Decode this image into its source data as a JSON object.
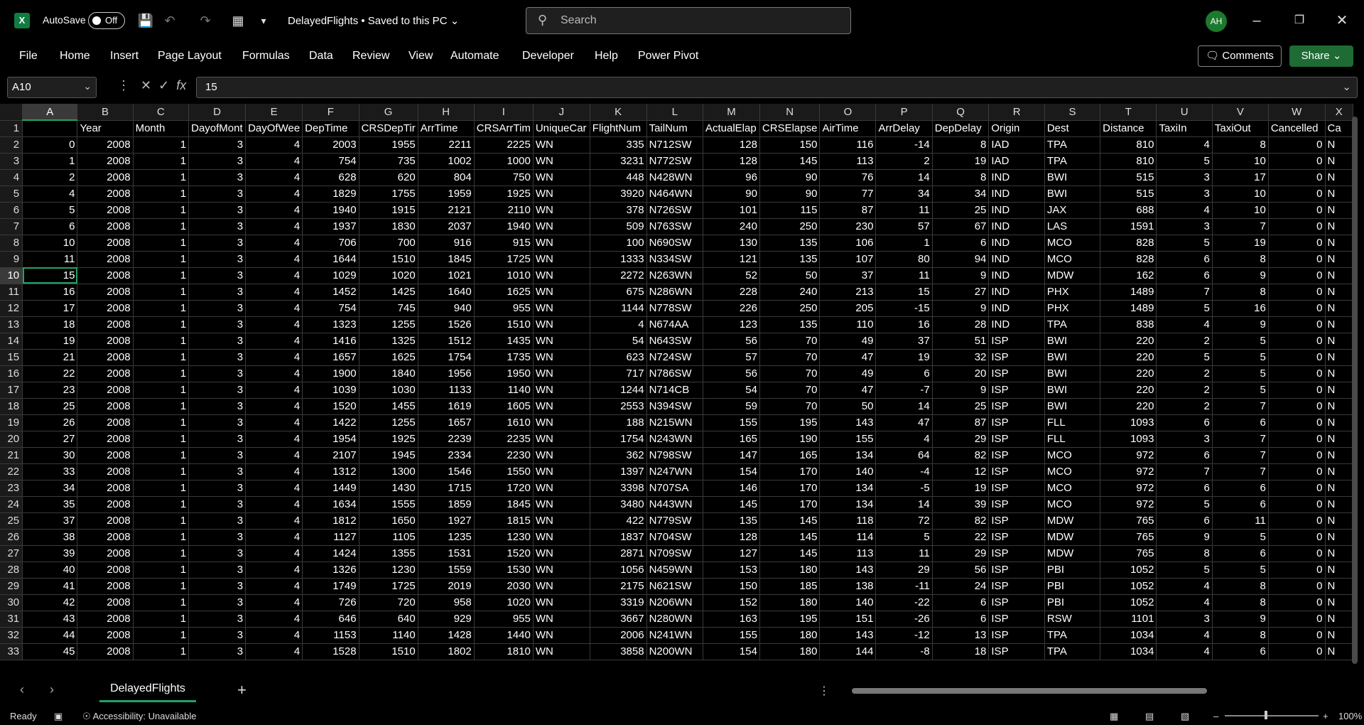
{
  "app": {
    "logo": "X",
    "autosave_label": "AutoSave",
    "autosave_state": "Off",
    "doc_title": "DelayedFlights • Saved to this PC",
    "search_placeholder": "Search",
    "user_initials": "AH"
  },
  "menu": [
    "File",
    "Home",
    "Insert",
    "Page Layout",
    "Formulas",
    "Data",
    "Review",
    "View",
    "Automate",
    "Developer",
    "Help",
    "Power Pivot"
  ],
  "buttons": {
    "comments": "Comments",
    "share": "Share"
  },
  "formula_bar": {
    "cell_ref": "A10",
    "value": "15"
  },
  "columns": [
    "A",
    "B",
    "C",
    "D",
    "E",
    "F",
    "G",
    "H",
    "I",
    "J",
    "K",
    "L",
    "M",
    "N",
    "O",
    "P",
    "Q",
    "R",
    "S",
    "T",
    "U",
    "V",
    "W",
    "X"
  ],
  "header_row": [
    "",
    "Year",
    "Month",
    "DayofMont",
    "DayOfWee",
    "DepTime",
    "CRSDepTir",
    "ArrTime",
    "CRSArrTim",
    "UniqueCar",
    "FlightNum",
    "TailNum",
    "ActualElap",
    "CRSElapse",
    "AirTime",
    "ArrDelay",
    "DepDelay",
    "Origin",
    "Dest",
    "Distance",
    "TaxiIn",
    "TaxiOut",
    "Cancelled",
    "Ca"
  ],
  "text_columns": [
    9,
    11,
    17,
    18,
    23
  ],
  "rows": [
    [
      0,
      2008,
      1,
      3,
      4,
      2003,
      1955,
      2211,
      2225,
      "WN",
      335,
      "N712SW",
      128,
      150,
      116,
      -14,
      8,
      "IAD",
      "TPA",
      810,
      4,
      8,
      0,
      "N"
    ],
    [
      1,
      2008,
      1,
      3,
      4,
      754,
      735,
      1002,
      1000,
      "WN",
      3231,
      "N772SW",
      128,
      145,
      113,
      2,
      19,
      "IAD",
      "TPA",
      810,
      5,
      10,
      0,
      "N"
    ],
    [
      2,
      2008,
      1,
      3,
      4,
      628,
      620,
      804,
      750,
      "WN",
      448,
      "N428WN",
      96,
      90,
      76,
      14,
      8,
      "IND",
      "BWI",
      515,
      3,
      17,
      0,
      "N"
    ],
    [
      4,
      2008,
      1,
      3,
      4,
      1829,
      1755,
      1959,
      1925,
      "WN",
      3920,
      "N464WN",
      90,
      90,
      77,
      34,
      34,
      "IND",
      "BWI",
      515,
      3,
      10,
      0,
      "N"
    ],
    [
      5,
      2008,
      1,
      3,
      4,
      1940,
      1915,
      2121,
      2110,
      "WN",
      378,
      "N726SW",
      101,
      115,
      87,
      11,
      25,
      "IND",
      "JAX",
      688,
      4,
      10,
      0,
      "N"
    ],
    [
      6,
      2008,
      1,
      3,
      4,
      1937,
      1830,
      2037,
      1940,
      "WN",
      509,
      "N763SW",
      240,
      250,
      230,
      57,
      67,
      "IND",
      "LAS",
      1591,
      3,
      7,
      0,
      "N"
    ],
    [
      10,
      2008,
      1,
      3,
      4,
      706,
      700,
      916,
      915,
      "WN",
      100,
      "N690SW",
      130,
      135,
      106,
      1,
      6,
      "IND",
      "MCO",
      828,
      5,
      19,
      0,
      "N"
    ],
    [
      11,
      2008,
      1,
      3,
      4,
      1644,
      1510,
      1845,
      1725,
      "WN",
      1333,
      "N334SW",
      121,
      135,
      107,
      80,
      94,
      "IND",
      "MCO",
      828,
      6,
      8,
      0,
      "N"
    ],
    [
      15,
      2008,
      1,
      3,
      4,
      1029,
      1020,
      1021,
      1010,
      "WN",
      2272,
      "N263WN",
      52,
      50,
      37,
      11,
      9,
      "IND",
      "MDW",
      162,
      6,
      9,
      0,
      "N"
    ],
    [
      16,
      2008,
      1,
      3,
      4,
      1452,
      1425,
      1640,
      1625,
      "WN",
      675,
      "N286WN",
      228,
      240,
      213,
      15,
      27,
      "IND",
      "PHX",
      1489,
      7,
      8,
      0,
      "N"
    ],
    [
      17,
      2008,
      1,
      3,
      4,
      754,
      745,
      940,
      955,
      "WN",
      1144,
      "N778SW",
      226,
      250,
      205,
      -15,
      9,
      "IND",
      "PHX",
      1489,
      5,
      16,
      0,
      "N"
    ],
    [
      18,
      2008,
      1,
      3,
      4,
      1323,
      1255,
      1526,
      1510,
      "WN",
      4,
      "N674AA",
      123,
      135,
      110,
      16,
      28,
      "IND",
      "TPA",
      838,
      4,
      9,
      0,
      "N"
    ],
    [
      19,
      2008,
      1,
      3,
      4,
      1416,
      1325,
      1512,
      1435,
      "WN",
      54,
      "N643SW",
      56,
      70,
      49,
      37,
      51,
      "ISP",
      "BWI",
      220,
      2,
      5,
      0,
      "N"
    ],
    [
      21,
      2008,
      1,
      3,
      4,
      1657,
      1625,
      1754,
      1735,
      "WN",
      623,
      "N724SW",
      57,
      70,
      47,
      19,
      32,
      "ISP",
      "BWI",
      220,
      5,
      5,
      0,
      "N"
    ],
    [
      22,
      2008,
      1,
      3,
      4,
      1900,
      1840,
      1956,
      1950,
      "WN",
      717,
      "N786SW",
      56,
      70,
      49,
      6,
      20,
      "ISP",
      "BWI",
      220,
      2,
      5,
      0,
      "N"
    ],
    [
      23,
      2008,
      1,
      3,
      4,
      1039,
      1030,
      1133,
      1140,
      "WN",
      1244,
      "N714CB",
      54,
      70,
      47,
      -7,
      9,
      "ISP",
      "BWI",
      220,
      2,
      5,
      0,
      "N"
    ],
    [
      25,
      2008,
      1,
      3,
      4,
      1520,
      1455,
      1619,
      1605,
      "WN",
      2553,
      "N394SW",
      59,
      70,
      50,
      14,
      25,
      "ISP",
      "BWI",
      220,
      2,
      7,
      0,
      "N"
    ],
    [
      26,
      2008,
      1,
      3,
      4,
      1422,
      1255,
      1657,
      1610,
      "WN",
      188,
      "N215WN",
      155,
      195,
      143,
      47,
      87,
      "ISP",
      "FLL",
      1093,
      6,
      6,
      0,
      "N"
    ],
    [
      27,
      2008,
      1,
      3,
      4,
      1954,
      1925,
      2239,
      2235,
      "WN",
      1754,
      "N243WN",
      165,
      190,
      155,
      4,
      29,
      "ISP",
      "FLL",
      1093,
      3,
      7,
      0,
      "N"
    ],
    [
      30,
      2008,
      1,
      3,
      4,
      2107,
      1945,
      2334,
      2230,
      "WN",
      362,
      "N798SW",
      147,
      165,
      134,
      64,
      82,
      "ISP",
      "MCO",
      972,
      6,
      7,
      0,
      "N"
    ],
    [
      33,
      2008,
      1,
      3,
      4,
      1312,
      1300,
      1546,
      1550,
      "WN",
      1397,
      "N247WN",
      154,
      170,
      140,
      -4,
      12,
      "ISP",
      "MCO",
      972,
      7,
      7,
      0,
      "N"
    ],
    [
      34,
      2008,
      1,
      3,
      4,
      1449,
      1430,
      1715,
      1720,
      "WN",
      3398,
      "N707SA",
      146,
      170,
      134,
      -5,
      19,
      "ISP",
      "MCO",
      972,
      6,
      6,
      0,
      "N"
    ],
    [
      35,
      2008,
      1,
      3,
      4,
      1634,
      1555,
      1859,
      1845,
      "WN",
      3480,
      "N443WN",
      145,
      170,
      134,
      14,
      39,
      "ISP",
      "MCO",
      972,
      5,
      6,
      0,
      "N"
    ],
    [
      37,
      2008,
      1,
      3,
      4,
      1812,
      1650,
      1927,
      1815,
      "WN",
      422,
      "N779SW",
      135,
      145,
      118,
      72,
      82,
      "ISP",
      "MDW",
      765,
      6,
      11,
      0,
      "N"
    ],
    [
      38,
      2008,
      1,
      3,
      4,
      1127,
      1105,
      1235,
      1230,
      "WN",
      1837,
      "N704SW",
      128,
      145,
      114,
      5,
      22,
      "ISP",
      "MDW",
      765,
      9,
      5,
      0,
      "N"
    ],
    [
      39,
      2008,
      1,
      3,
      4,
      1424,
      1355,
      1531,
      1520,
      "WN",
      2871,
      "N709SW",
      127,
      145,
      113,
      11,
      29,
      "ISP",
      "MDW",
      765,
      8,
      6,
      0,
      "N"
    ],
    [
      40,
      2008,
      1,
      3,
      4,
      1326,
      1230,
      1559,
      1530,
      "WN",
      1056,
      "N459WN",
      153,
      180,
      143,
      29,
      56,
      "ISP",
      "PBI",
      1052,
      5,
      5,
      0,
      "N"
    ],
    [
      41,
      2008,
      1,
      3,
      4,
      1749,
      1725,
      2019,
      2030,
      "WN",
      2175,
      "N621SW",
      150,
      185,
      138,
      -11,
      24,
      "ISP",
      "PBI",
      1052,
      4,
      8,
      0,
      "N"
    ],
    [
      42,
      2008,
      1,
      3,
      4,
      726,
      720,
      958,
      1020,
      "WN",
      3319,
      "N206WN",
      152,
      180,
      140,
      -22,
      6,
      "ISP",
      "PBI",
      1052,
      4,
      8,
      0,
      "N"
    ],
    [
      43,
      2008,
      1,
      3,
      4,
      646,
      640,
      929,
      955,
      "WN",
      3667,
      "N280WN",
      163,
      195,
      151,
      -26,
      6,
      "ISP",
      "RSW",
      1101,
      3,
      9,
      0,
      "N"
    ],
    [
      44,
      2008,
      1,
      3,
      4,
      1153,
      1140,
      1428,
      1440,
      "WN",
      2006,
      "N241WN",
      155,
      180,
      143,
      -12,
      13,
      "ISP",
      "TPA",
      1034,
      4,
      8,
      0,
      "N"
    ],
    [
      45,
      2008,
      1,
      3,
      4,
      1528,
      1510,
      1802,
      1810,
      "WN",
      3858,
      "N200WN",
      154,
      180,
      144,
      -8,
      18,
      "ISP",
      "TPA",
      1034,
      4,
      6,
      0,
      "N"
    ]
  ],
  "sheet_tab": "DelayedFlights",
  "status": {
    "ready": "Ready",
    "accessibility": "Accessibility: Unavailable",
    "zoom": "100%"
  },
  "colors": {
    "accent": "#21a366",
    "share": "#1e6b34",
    "avatar": "#1b7a2e"
  }
}
